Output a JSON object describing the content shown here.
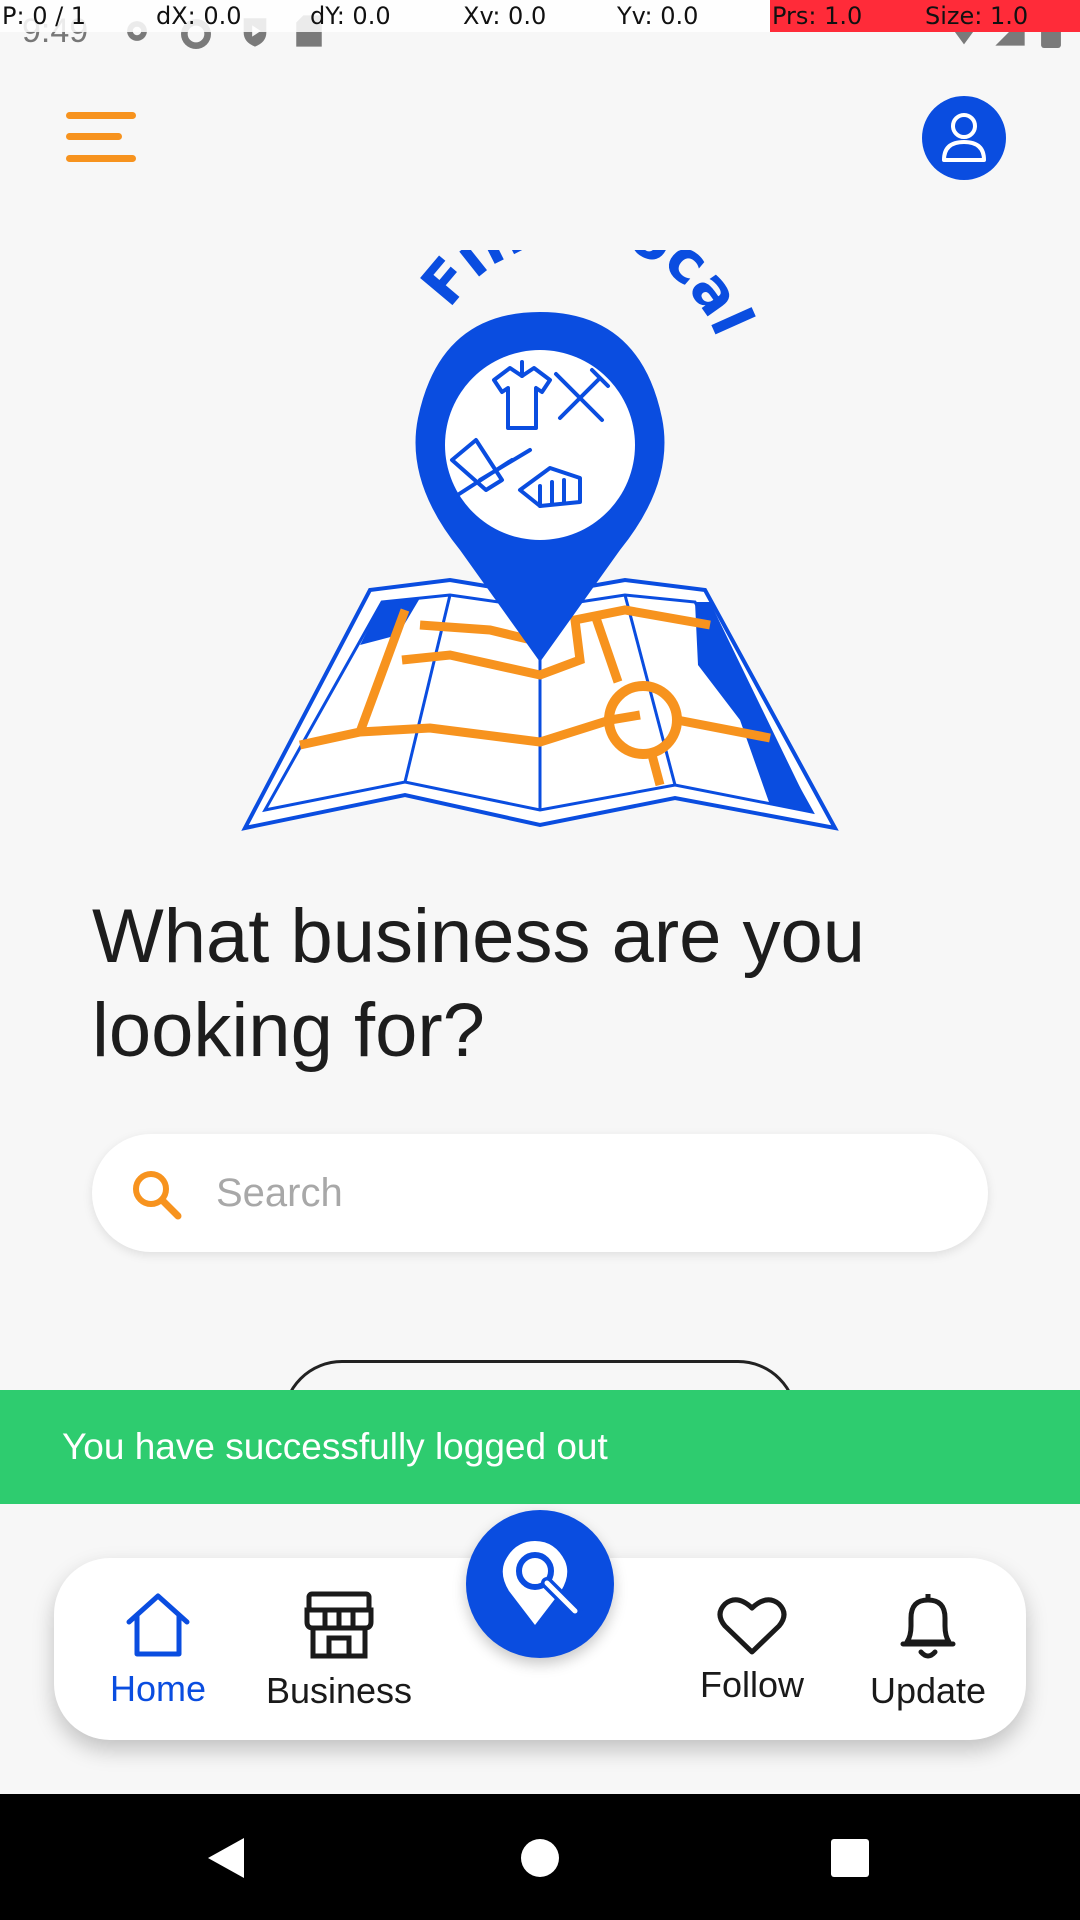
{
  "debug_overlay": {
    "pointer": "P: 0 / 1",
    "dx": "dX: 0.0",
    "dy": "dY: 0.0",
    "xv": "Xv: 0.0",
    "yv": "Yv: 0.0",
    "prs": "Prs: 1.0",
    "size": "Size: 1.0"
  },
  "status_bar": {
    "time": "9:49",
    "icons": [
      "gear-icon",
      "sync-icon",
      "shield-play-icon",
      "sd-card-icon",
      "wifi-icon",
      "signal-icon",
      "battery-icon"
    ]
  },
  "header": {
    "menu_icon": "hamburger-menu-icon",
    "profile_icon": "user-icon"
  },
  "logo": {
    "text": "Find Local"
  },
  "headline": "What business are you looking for?",
  "search": {
    "placeholder": "Search",
    "value": ""
  },
  "toast": {
    "message": "You have successfully logged out"
  },
  "bottom_nav": {
    "items": [
      {
        "label": "Home",
        "icon": "home-icon",
        "active": true
      },
      {
        "label": "Business",
        "icon": "store-icon",
        "active": false
      },
      {
        "label": "Follow",
        "icon": "heart-icon",
        "active": false
      },
      {
        "label": "Update",
        "icon": "bell-icon",
        "active": false
      }
    ],
    "center_icon": "location-search-icon"
  },
  "system_nav": [
    "back-icon",
    "home-circle-icon",
    "recents-icon"
  ],
  "colors": {
    "brand_blue": "#0a4de0",
    "accent_orange": "#f7931e",
    "toast_green": "#2ecc6f",
    "background": "#f7f7f7"
  }
}
